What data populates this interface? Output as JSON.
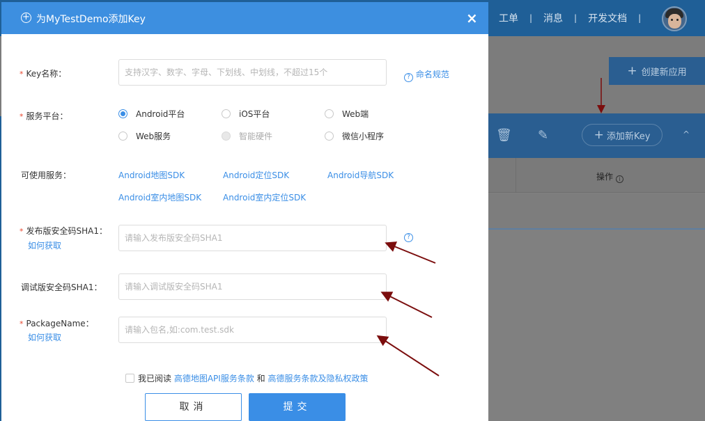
{
  "background": {
    "nav": [
      "工单",
      "消息",
      "开发文档"
    ],
    "nav_separator": "|",
    "create_app_button": "创建新应用",
    "add_key_button": "添加新Key",
    "table_header_action": "操作",
    "action_info_glyph": "i"
  },
  "modal": {
    "title": "为MyTestDemo添加Key",
    "plus_circle_glyph": "+",
    "close_glyph": "×",
    "required_mark": "*",
    "help_glyph": "?",
    "key_name": {
      "label": "Key名称：",
      "placeholder": "支持汉字、数字、字母、下划线、中划线，不超过15个",
      "help_link": "命名规范"
    },
    "platform": {
      "label": "服务平台：",
      "options": [
        {
          "label": "Android平台",
          "checked": true,
          "disabled": false
        },
        {
          "label": "iOS平台",
          "checked": false,
          "disabled": false
        },
        {
          "label": "Web端",
          "checked": false,
          "disabled": false
        },
        {
          "label": "Web服务",
          "checked": false,
          "disabled": false
        },
        {
          "label": "智能硬件",
          "checked": false,
          "disabled": true
        },
        {
          "label": "微信小程序",
          "checked": false,
          "disabled": false
        }
      ]
    },
    "services": {
      "label": "可使用服务：",
      "items": [
        "Android地图SDK",
        "Android定位SDK",
        "Android导航SDK",
        "Android室内地图SDK",
        "Android室内定位SDK"
      ]
    },
    "release_sha1": {
      "label": "发布版安全码SHA1：",
      "how_link": "如何获取",
      "placeholder": "请输入发布版安全码SHA1"
    },
    "debug_sha1": {
      "label": "调试版安全码SHA1：",
      "placeholder": "请输入调试版安全码SHA1"
    },
    "package_name": {
      "label": "PackageName：",
      "how_link": "如何获取",
      "placeholder": "请输入包名,如:com.test.sdk"
    },
    "agreement": {
      "prefix": "我已阅读",
      "link1": "高德地图API服务条款",
      "middle": "和",
      "link2": "高德服务条款及隐私权政策"
    },
    "cancel_button": "取消",
    "submit_button": "提交"
  },
  "colors": {
    "primary": "#3d8fe0",
    "link": "#3a8ee6",
    "required": "#e8462e",
    "arrow": "#7b0d0d"
  }
}
